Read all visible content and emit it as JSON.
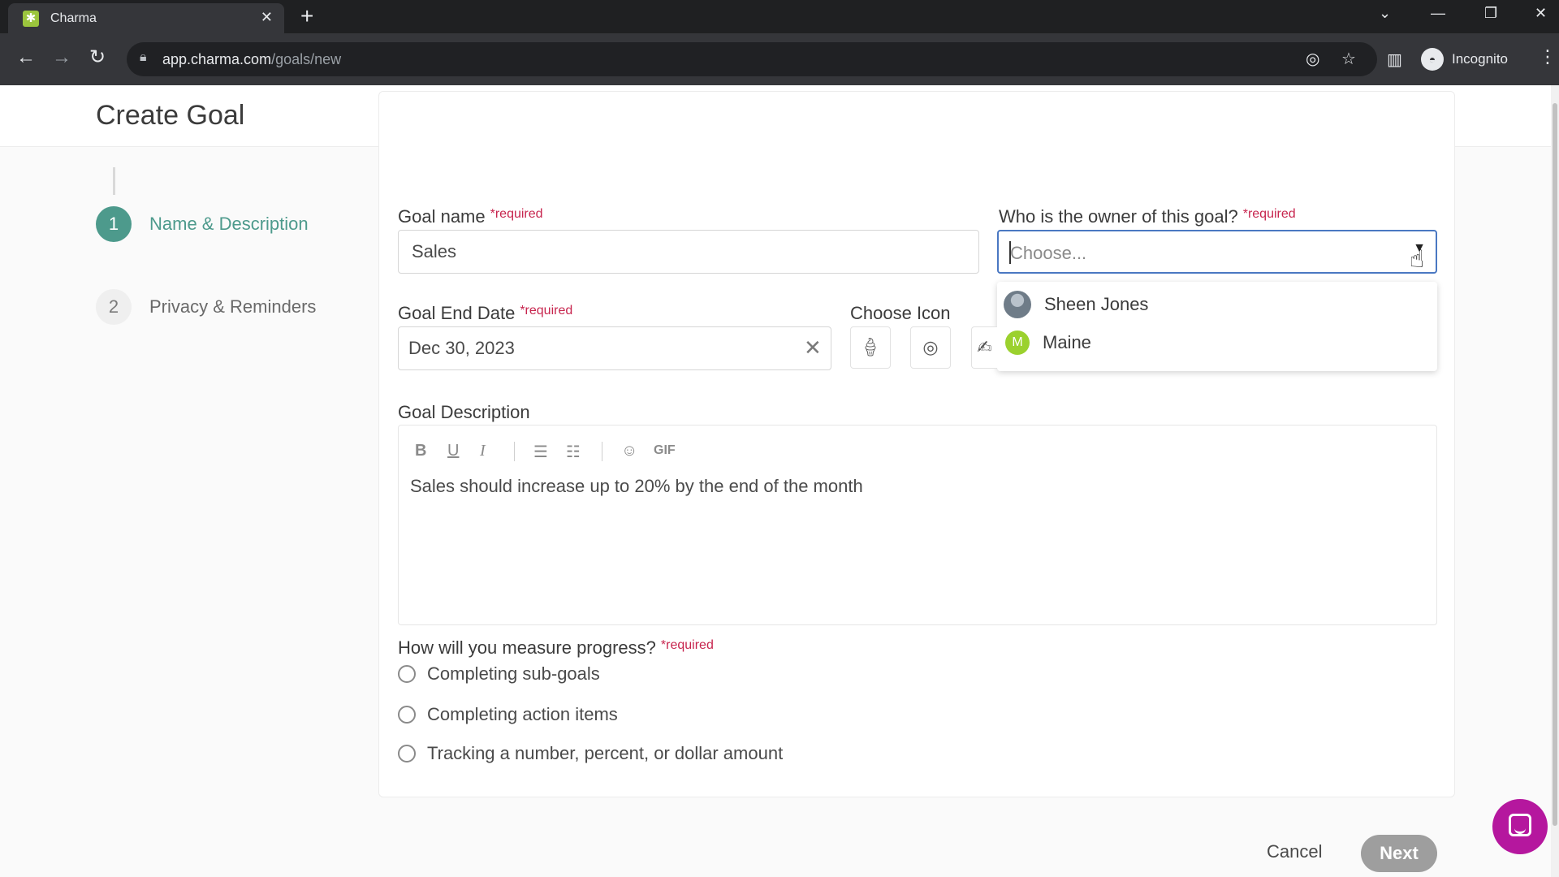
{
  "browser": {
    "tab_title": "Charma",
    "tab_close": "✕",
    "new_tab": "+",
    "url_host": "app.charma.com",
    "url_path": "/goals/new",
    "incognito_label": "Incognito"
  },
  "page": {
    "title": "Create Goal"
  },
  "steps": [
    {
      "number": "1",
      "label": "Name & Description"
    },
    {
      "number": "2",
      "label": "Privacy & Reminders"
    }
  ],
  "form": {
    "required_tag": "*required",
    "goal_name": {
      "label": "Goal name",
      "value": "Sales"
    },
    "owner": {
      "label": "Who is the owner of this goal?",
      "placeholder": "Choose...",
      "options": [
        {
          "name": "Sheen Jones",
          "avatar": "photo"
        },
        {
          "name": "Maine",
          "avatar": "M"
        }
      ]
    },
    "end_date": {
      "label": "Goal End Date",
      "value": "Dec 30, 2023",
      "clear": "✕"
    },
    "choose_icon": {
      "label": "Choose Icon",
      "icons": [
        "ice-cream-icon",
        "target-icon",
        "signature-icon"
      ]
    },
    "description": {
      "label": "Goal Description",
      "toolbar": {
        "bold": "B",
        "underline": "U",
        "italic": "I",
        "bullet_list": "☰",
        "numbered_list": "☷",
        "emoji": "☺",
        "gif": "GIF"
      },
      "text": "Sales should increase up to 20% by the end of the month"
    },
    "measure": {
      "label": "How will you measure progress?",
      "options": [
        "Completing sub-goals",
        "Completing action items",
        "Tracking a number, percent, or dollar amount"
      ]
    },
    "cancel_label": "Cancel",
    "next_label": "Next"
  },
  "colors": {
    "accent": "#4d9a8c",
    "required": "#c7254e",
    "focus": "#4a78c2",
    "chat": "#b5179e"
  }
}
